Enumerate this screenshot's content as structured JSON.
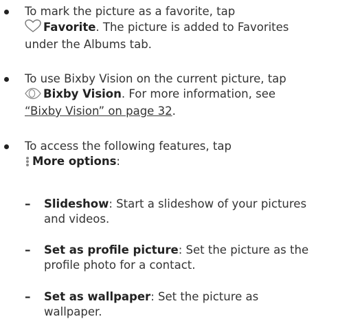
{
  "bullets": [
    {
      "lines": [
        "To mark the picture as a favorite, tap",
        "Favorite",
        ". The picture is added to Favorites",
        "under the Albums tab."
      ]
    },
    {
      "lines": [
        "To use Bixby Vision on the current picture, tap",
        "Bixby Vision",
        ". For more information, see",
        "“Bixby Vision” on page 32",
        "."
      ]
    },
    {
      "lines": [
        "To access the following features, tap",
        "More options",
        ":"
      ]
    }
  ],
  "sub_items": [
    {
      "term": "Slideshow",
      "text1": ": Start a slideshow of your pictures",
      "text2": "and videos."
    },
    {
      "term": "Set as profile picture",
      "text1": ": Set the picture as the",
      "text2": "profile photo for a contact."
    },
    {
      "term": "Set as wallpaper",
      "text1": ": Set the picture as",
      "text2": "wallpaper."
    }
  ],
  "dash_char": "–",
  "icons": [
    "heart-outline-icon",
    "bixby-vision-eye-icon",
    "more-options-vertical-dots-icon"
  ]
}
